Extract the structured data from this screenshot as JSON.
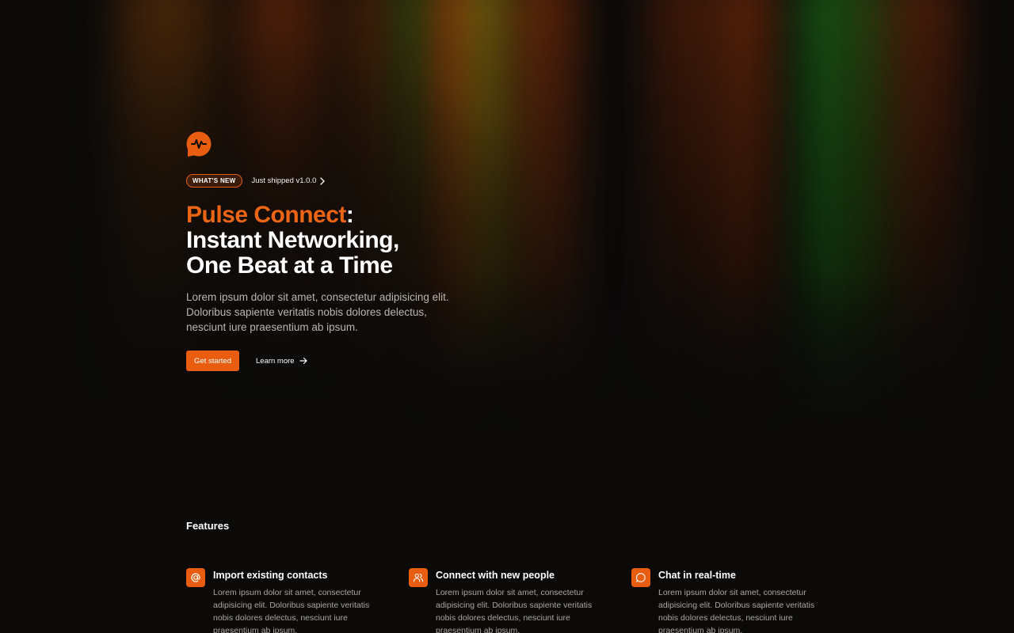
{
  "theme": {
    "background": "#0b0a09",
    "accent": "#e85d10",
    "brand_text": "#ec6514",
    "muted_text": "#b9b6b2"
  },
  "hero": {
    "logo_icon": "pulse-chat-icon",
    "badge": "WHAT'S NEW",
    "announcement": "Just shipped v1.0.0",
    "headline_brand": "Pulse Connect",
    "headline_colon": ":",
    "headline_line2": "Instant Networking,",
    "headline_line3": "One Beat at a Time",
    "description": "Lorem ipsum dolor sit amet, consectetur adipisicing elit. Doloribus sapiente veritatis nobis dolores delectus, nesciunt iure praesentium ab ipsum.",
    "primary_cta": "Get started",
    "secondary_cta": "Learn more"
  },
  "features": {
    "title": "Features",
    "items": [
      {
        "icon": "at-sign-icon",
        "title": "Import existing contacts",
        "description": "Lorem ipsum dolor sit amet, consectetur adipisicing elit. Doloribus sapiente veritatis nobis dolores delectus, nesciunt iure praesentium ab ipsum."
      },
      {
        "icon": "users-icon",
        "title": "Connect with new people",
        "description": "Lorem ipsum dolor sit amet, consectetur adipisicing elit. Doloribus sapiente veritatis nobis dolores delectus, nesciunt iure praesentium ab ipsum."
      },
      {
        "icon": "chat-bubble-icon",
        "title": "Chat in real-time",
        "description": "Lorem ipsum dolor sit amet, consectetur adipisicing elit. Doloribus sapiente veritatis nobis dolores delectus, nesciunt iure praesentium ab ipsum."
      }
    ]
  }
}
